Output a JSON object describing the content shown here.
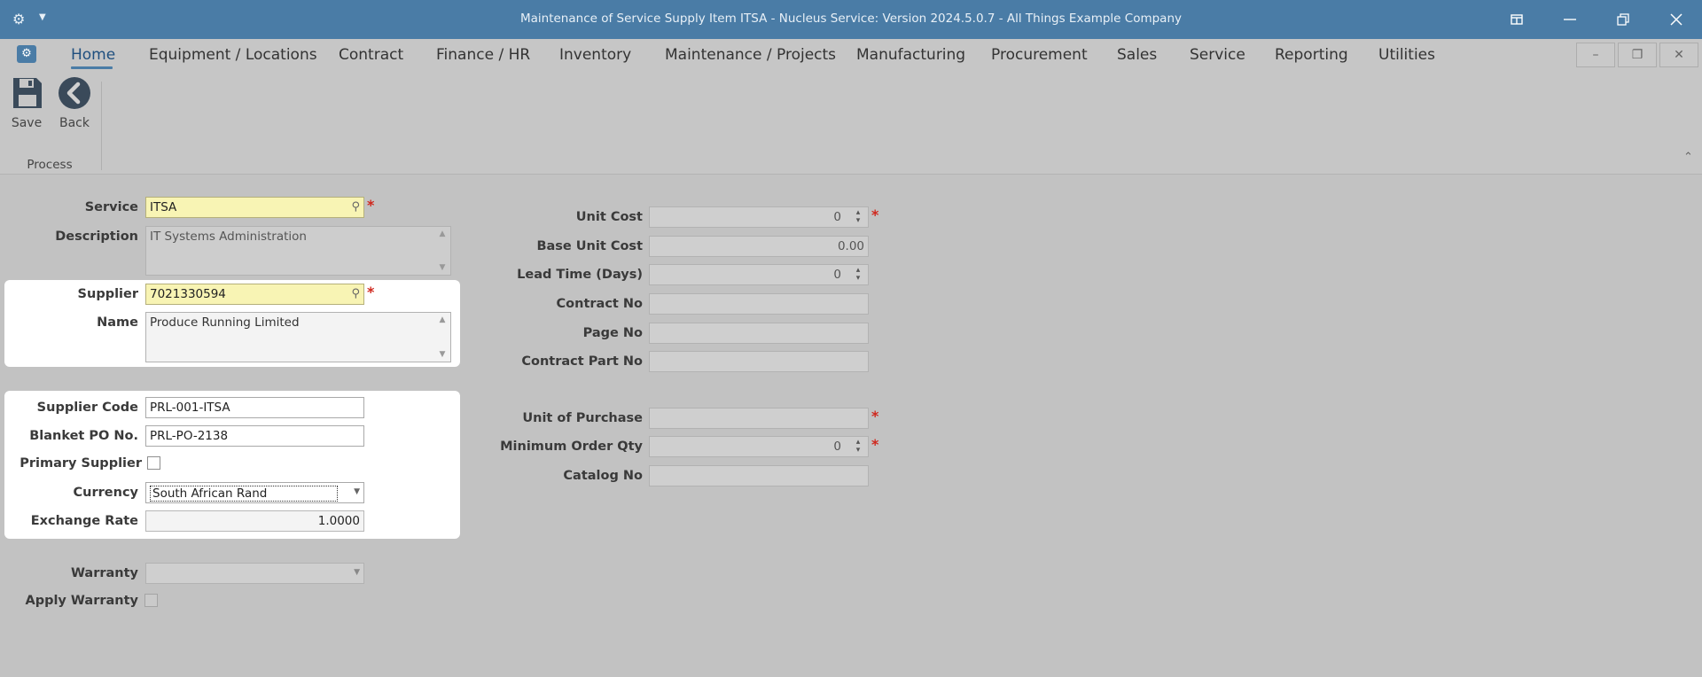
{
  "titlebar": {
    "app_menu_icon": "gear-icon",
    "title": "Maintenance of Service Supply Item ITSA - Nucleus Service: Version 2024.5.0.7 - All Things Example Company"
  },
  "menu": {
    "items": [
      {
        "label": "Home"
      },
      {
        "label": "Equipment / Locations"
      },
      {
        "label": "Contract"
      },
      {
        "label": "Finance / HR"
      },
      {
        "label": "Inventory"
      },
      {
        "label": "Maintenance / Projects"
      },
      {
        "label": "Manufacturing"
      },
      {
        "label": "Procurement"
      },
      {
        "label": "Sales"
      },
      {
        "label": "Service"
      },
      {
        "label": "Reporting"
      },
      {
        "label": "Utilities"
      }
    ]
  },
  "ribbon": {
    "save_label": "Save",
    "back_label": "Back",
    "group_label": "Process"
  },
  "form": {
    "service": {
      "label": "Service",
      "value": "ITSA"
    },
    "description": {
      "label": "Description",
      "value": "IT Systems Administration"
    },
    "supplier": {
      "label": "Supplier",
      "value": "7021330594"
    },
    "name": {
      "label": "Name",
      "value": "Produce Running Limited"
    },
    "supplier_code": {
      "label": "Supplier Code",
      "value": "PRL-001-ITSA"
    },
    "blanket_po": {
      "label": "Blanket PO No.",
      "value": "PRL-PO-2138"
    },
    "primary_supplier": {
      "label": "Primary Supplier",
      "checked": false
    },
    "currency": {
      "label": "Currency",
      "value": "South African Rand"
    },
    "exchange_rate": {
      "label": "Exchange Rate",
      "value": "1.0000"
    },
    "warranty": {
      "label": "Warranty",
      "value": ""
    },
    "apply_warranty": {
      "label": "Apply Warranty",
      "checked": false
    },
    "unit_cost": {
      "label": "Unit Cost",
      "value": "0"
    },
    "base_unit_cost": {
      "label": "Base Unit Cost",
      "value": "0.00"
    },
    "lead_time": {
      "label": "Lead Time (Days)",
      "value": "0"
    },
    "contract_no": {
      "label": "Contract No",
      "value": ""
    },
    "page_no": {
      "label": "Page No",
      "value": ""
    },
    "contract_part_no": {
      "label": "Contract Part No",
      "value": ""
    },
    "unit_of_purchase": {
      "label": "Unit of Purchase",
      "value": ""
    },
    "min_order_qty": {
      "label": "Minimum Order Qty",
      "value": "0"
    },
    "catalog_no": {
      "label": "Catalog No",
      "value": ""
    }
  },
  "colors": {
    "titlebar": "#4a7ca6",
    "background": "#c2c2c2",
    "required": "#d0271d",
    "lookup_field": "#f8f4b4"
  }
}
